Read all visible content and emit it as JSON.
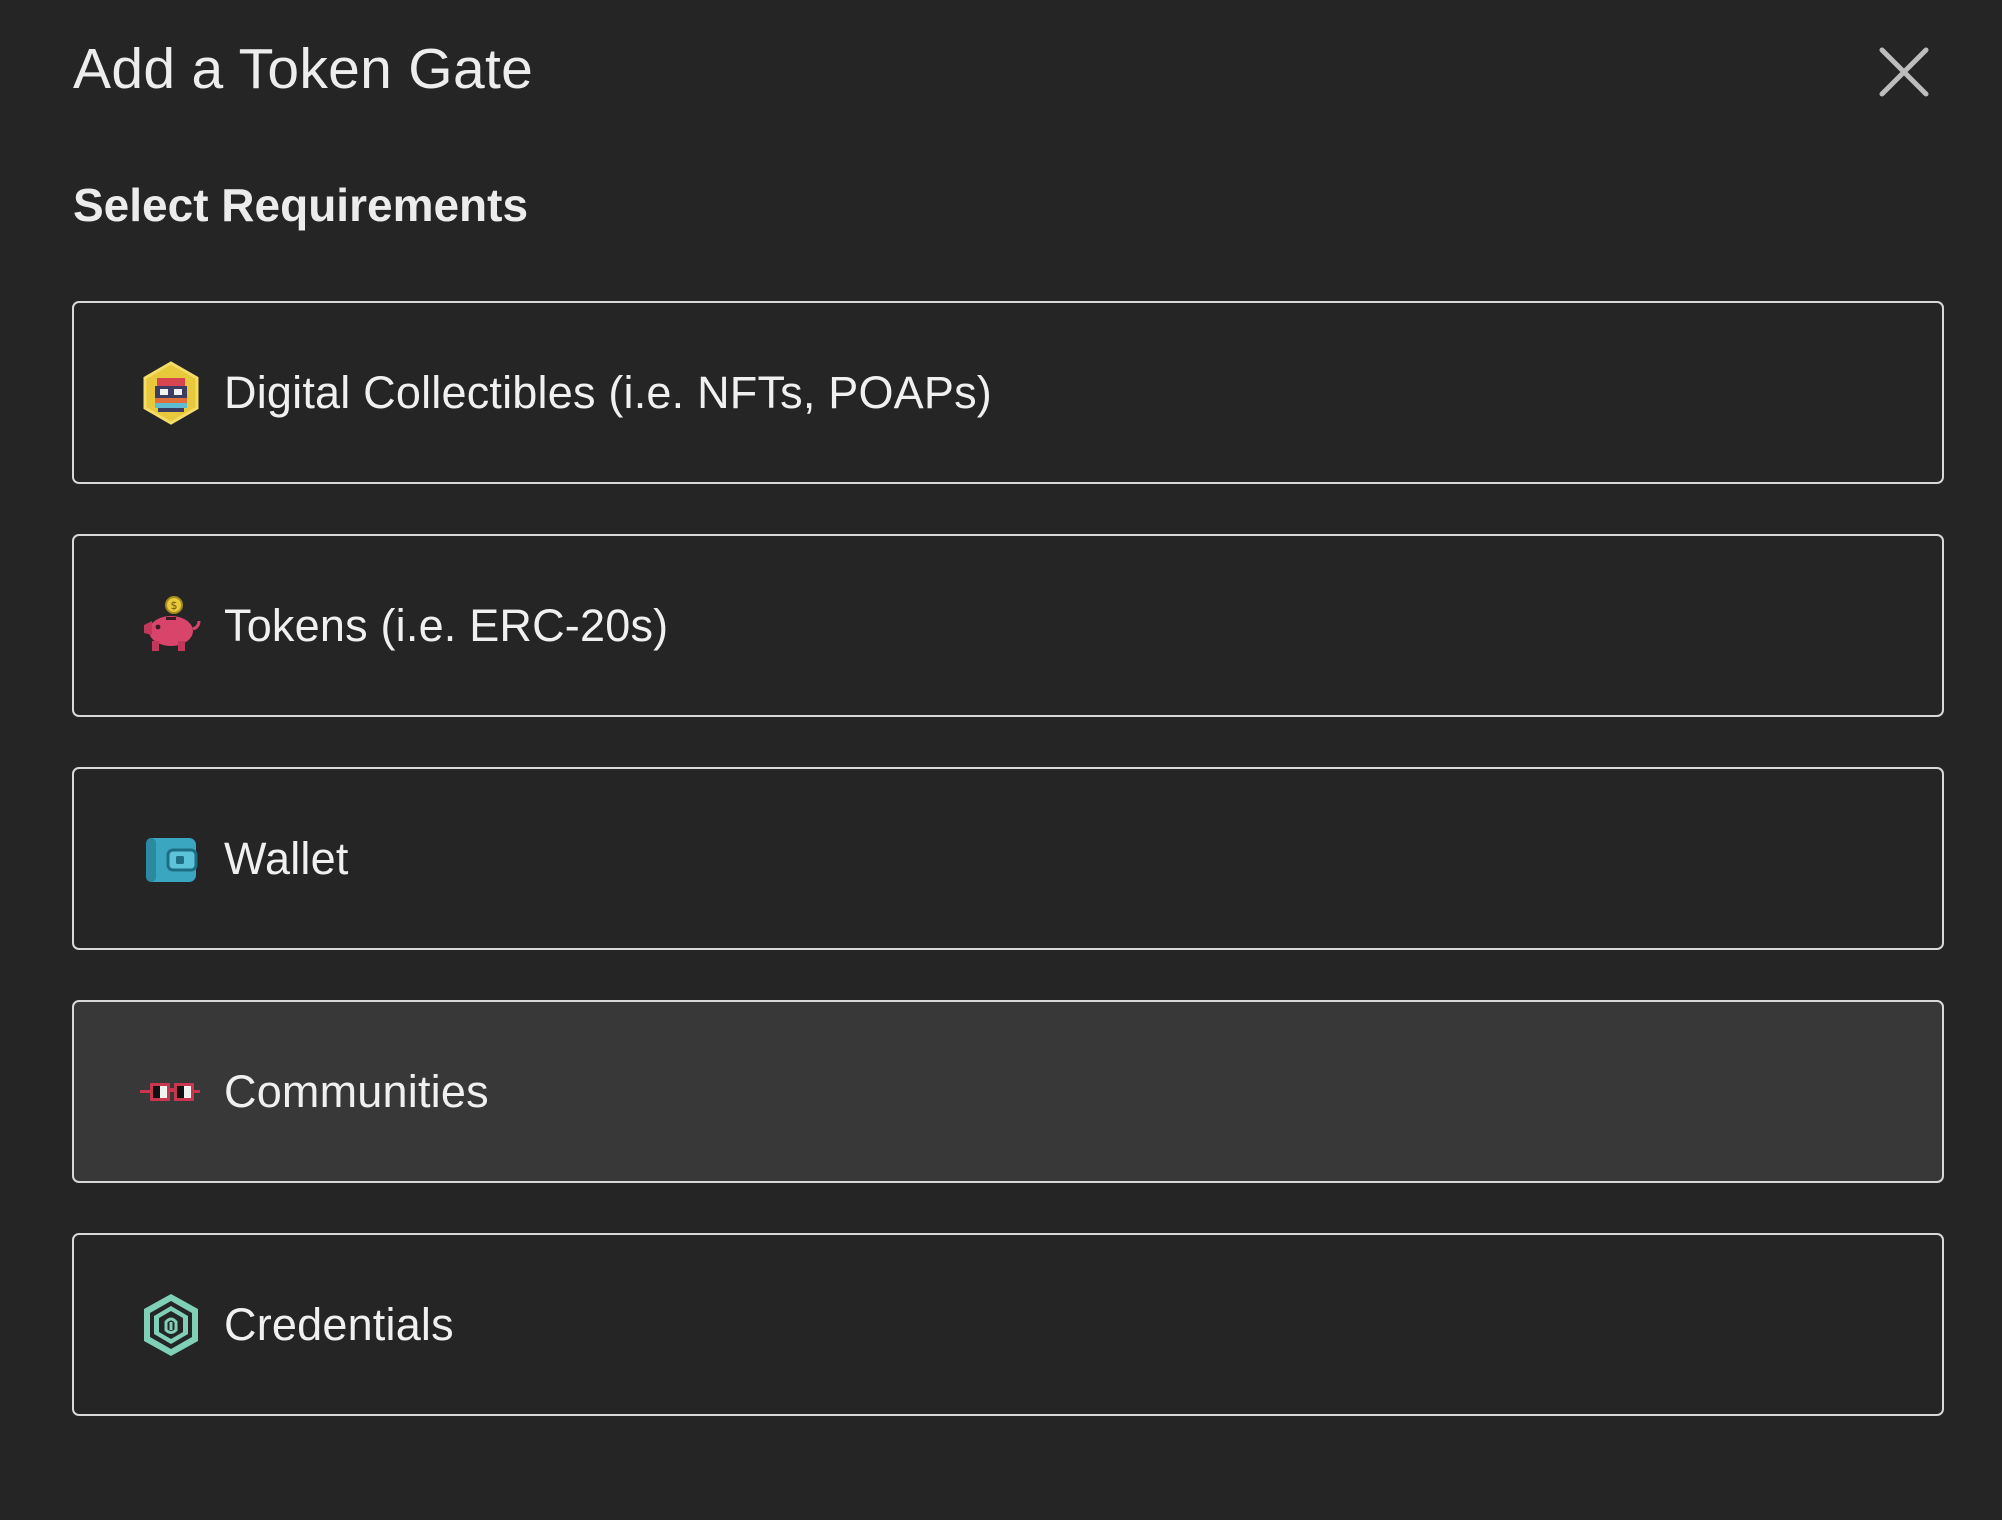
{
  "dialog": {
    "title": "Add a Token Gate",
    "close_icon": "close-icon"
  },
  "section": {
    "heading": "Select Requirements"
  },
  "options": [
    {
      "label": "Digital Collectibles (i.e. NFTs, POAPs)",
      "icon": "nft-badge-icon",
      "highlighted": false
    },
    {
      "label": "Tokens (i.e. ERC-20s)",
      "icon": "piggy-bank-icon",
      "highlighted": false
    },
    {
      "label": "Wallet",
      "icon": "wallet-icon",
      "highlighted": false
    },
    {
      "label": "Communities",
      "icon": "glasses-icon",
      "highlighted": true
    },
    {
      "label": "Credentials",
      "icon": "fingerprint-hexagon-icon",
      "highlighted": false
    }
  ],
  "colors": {
    "background": "#252526",
    "option_border": "#d8d8d8",
    "option_highlight": "#383838",
    "text": "#ececec"
  }
}
